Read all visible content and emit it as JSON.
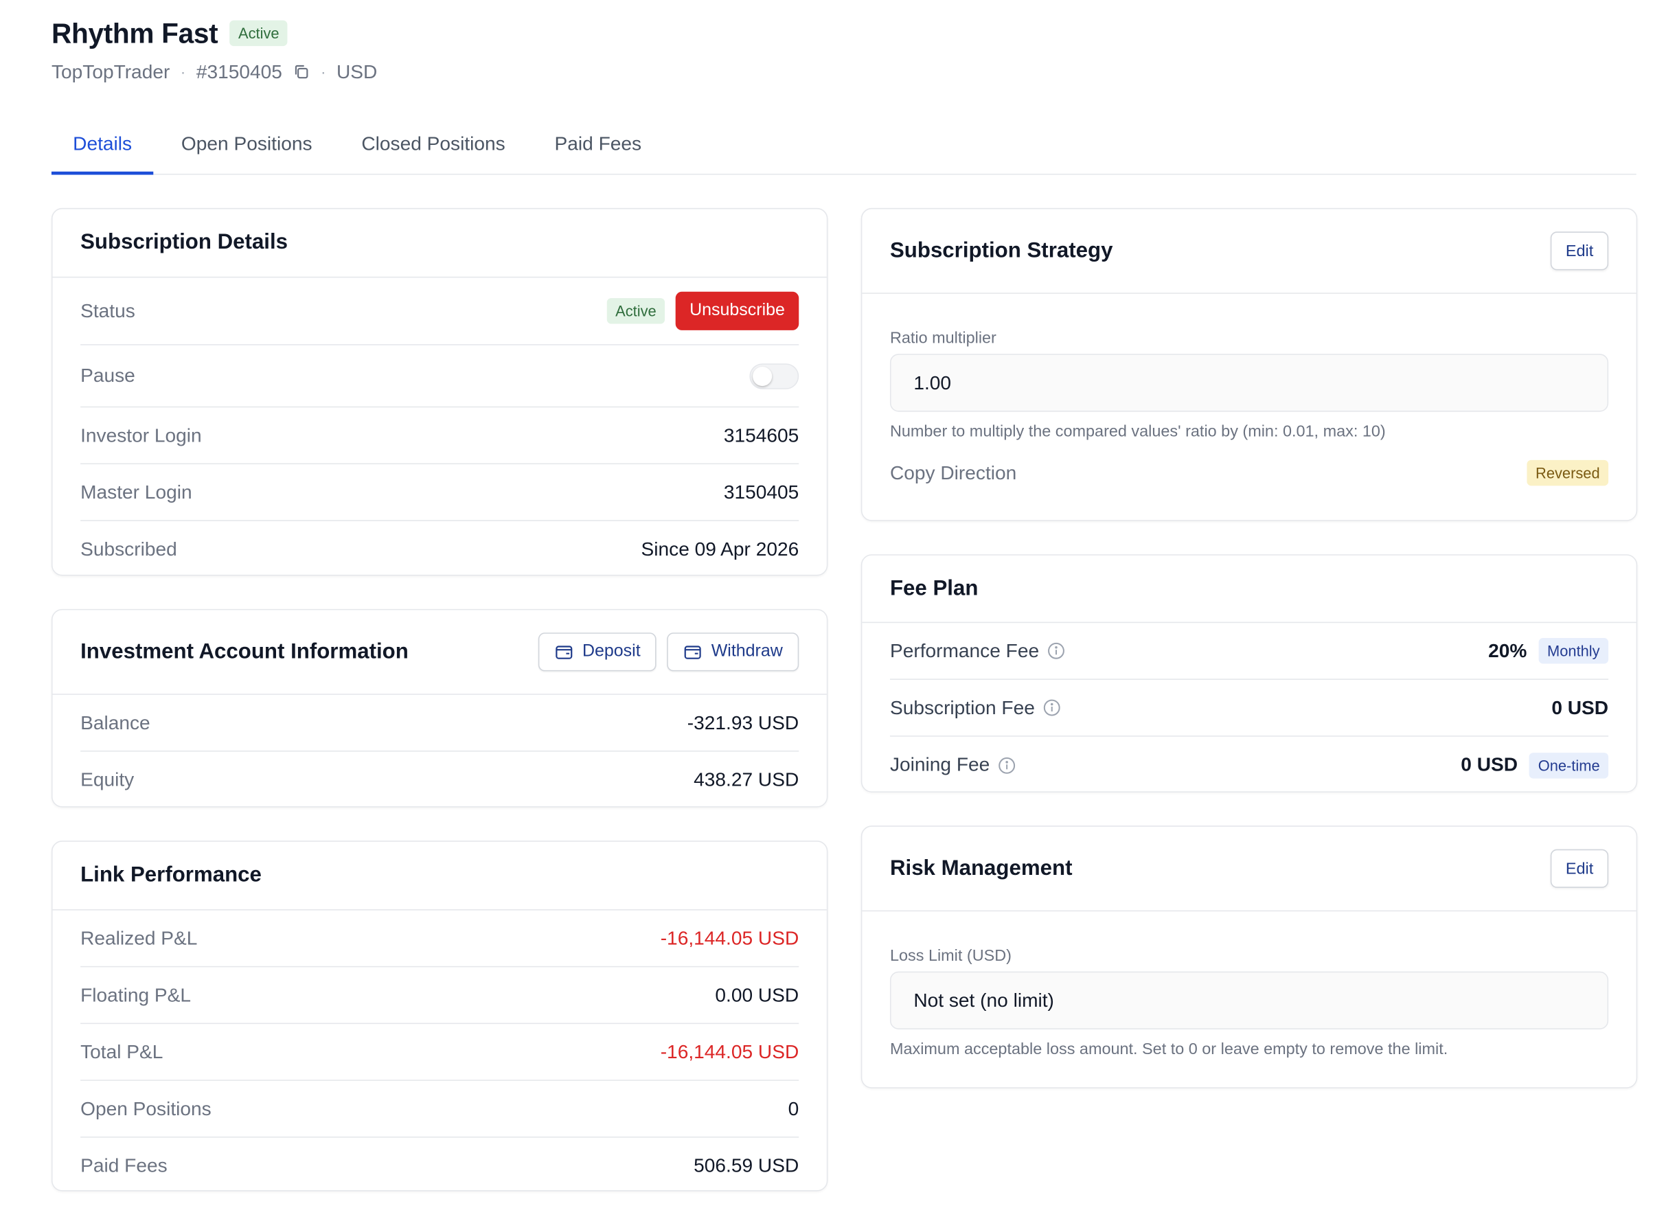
{
  "header": {
    "title": "Rhythm Fast",
    "status_badge": "Active",
    "provider": "TopTopTrader",
    "account_id": "#3150405",
    "currency": "USD"
  },
  "tabs": [
    {
      "label": "Details",
      "active": true
    },
    {
      "label": "Open Positions",
      "active": false
    },
    {
      "label": "Closed Positions",
      "active": false
    },
    {
      "label": "Paid Fees",
      "active": false
    }
  ],
  "subscription_details": {
    "title": "Subscription Details",
    "status_label": "Status",
    "status_value": "Active",
    "unsubscribe_label": "Unsubscribe",
    "pause_label": "Pause",
    "pause_on": false,
    "investor_login_label": "Investor Login",
    "investor_login_value": "3154605",
    "master_login_label": "Master Login",
    "master_login_value": "3150405",
    "subscribed_label": "Subscribed",
    "subscribed_value": "Since 09 Apr 2026"
  },
  "investment_account": {
    "title": "Investment Account Information",
    "deposit_label": "Deposit",
    "withdraw_label": "Withdraw",
    "balance_label": "Balance",
    "balance_value": "-321.93 USD",
    "equity_label": "Equity",
    "equity_value": "438.27 USD"
  },
  "link_performance": {
    "title": "Link Performance",
    "realized_label": "Realized P&L",
    "realized_value": "-16,144.05 USD",
    "floating_label": "Floating P&L",
    "floating_value": "0.00 USD",
    "total_label": "Total P&L",
    "total_value": "-16,144.05 USD",
    "open_positions_label": "Open Positions",
    "open_positions_value": "0",
    "paid_fees_label": "Paid Fees",
    "paid_fees_value": "506.59 USD"
  },
  "subscription_strategy": {
    "title": "Subscription Strategy",
    "edit_label": "Edit",
    "ratio_label": "Ratio multiplier",
    "ratio_value": "1.00",
    "ratio_help": "Number to multiply the compared values' ratio by (min: 0.01, max: 10)",
    "copy_direction_label": "Copy Direction",
    "copy_direction_value": "Reversed"
  },
  "fee_plan": {
    "title": "Fee Plan",
    "performance_label": "Performance Fee",
    "performance_value": "20%",
    "performance_period": "Monthly",
    "subscription_label": "Subscription Fee",
    "subscription_value": "0 USD",
    "joining_label": "Joining Fee",
    "joining_value": "0 USD",
    "joining_period": "One-time"
  },
  "risk_management": {
    "title": "Risk Management",
    "edit_label": "Edit",
    "loss_limit_label": "Loss Limit (USD)",
    "loss_limit_value": "Not set (no limit)",
    "loss_limit_help": "Maximum acceptable loss amount. Set to 0 or leave empty to remove the limit."
  },
  "colors": {
    "accent": "#1d4ed8",
    "danger": "#dc2626",
    "success_bg": "#e3f3e6",
    "warning_bg": "#fbf1c6"
  },
  "icons": {
    "copy": "copy-icon",
    "wallet": "wallet-icon",
    "info": "info-icon"
  }
}
